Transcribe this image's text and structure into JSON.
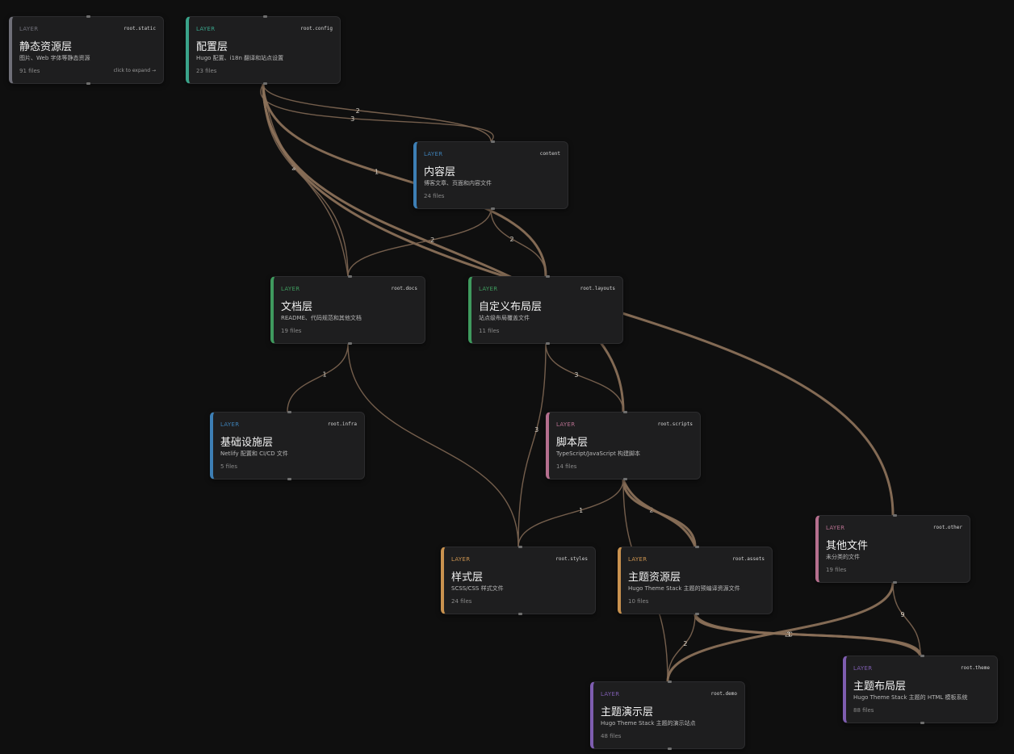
{
  "colors": {
    "background": "#0f0f0f",
    "card": "#1e1e1f",
    "edge": "#7a6350",
    "accent_gray": "#6f6f78",
    "accent_teal": "#3aa38a",
    "accent_blue": "#3d7fb5",
    "accent_green": "#3f9a5e",
    "accent_pink": "#b56f8e",
    "accent_orange": "#c9924f",
    "accent_purple": "#7e5db0"
  },
  "nodes": [
    {
      "key": "static",
      "layer_tag": "LAYER",
      "id": "root.static",
      "title": "静态资源层",
      "desc": "图片、Web 字体等静态资源",
      "count": "91 files",
      "link": "click to expand →",
      "accent": "#6f6f78"
    },
    {
      "key": "config",
      "layer_tag": "LAYER",
      "id": "root.config",
      "title": "配置层",
      "desc": "Hugo 配置、i18n 翻译和站点设置",
      "count": "23 files",
      "link": "",
      "accent": "#3aa38a"
    },
    {
      "key": "content",
      "layer_tag": "LAYER",
      "id": "content",
      "title": "内容层",
      "desc": "博客文章、页面和内容文件",
      "count": "24 files",
      "link": "",
      "accent": "#3d7fb5"
    },
    {
      "key": "docs",
      "layer_tag": "LAYER",
      "id": "root.docs",
      "title": "文档层",
      "desc": "README、代码规范和其他文档",
      "count": "19 files",
      "link": "",
      "accent": "#3f9a5e"
    },
    {
      "key": "custom_layouts",
      "layer_tag": "LAYER",
      "id": "root.layouts",
      "title": "自定义布局层",
      "desc": "站点级布局覆盖文件",
      "count": "11 files",
      "link": "",
      "accent": "#3f9a5e"
    },
    {
      "key": "infra",
      "layer_tag": "LAYER",
      "id": "root.infra",
      "title": "基础设施层",
      "desc": "Netlify 配置和 CI/CD 文件",
      "count": "5 files",
      "link": "",
      "accent": "#3d7fb5"
    },
    {
      "key": "scripts",
      "layer_tag": "LAYER",
      "id": "root.scripts",
      "title": "脚本层",
      "desc": "TypeScript/JavaScript 构建脚本",
      "count": "14 files",
      "link": "",
      "accent": "#b56f8e"
    },
    {
      "key": "other",
      "layer_tag": "LAYER",
      "id": "root.other",
      "title": "其他文件",
      "desc": "未分类的文件",
      "count": "19 files",
      "link": "",
      "accent": "#b56f8e"
    },
    {
      "key": "styles",
      "layer_tag": "LAYER",
      "id": "root.styles",
      "title": "样式层",
      "desc": "SCSS/CSS 样式文件",
      "count": "24 files",
      "link": "",
      "accent": "#c9924f"
    },
    {
      "key": "theme_assets",
      "layer_tag": "LAYER",
      "id": "root.assets",
      "title": "主题资源层",
      "desc": "Hugo Theme Stack 主题的预编译资源文件",
      "count": "10 files",
      "link": "",
      "accent": "#c9924f"
    },
    {
      "key": "theme_layouts",
      "layer_tag": "LAYER",
      "id": "root.theme",
      "title": "主题布局层",
      "desc": "Hugo Theme Stack 主题的 HTML 模板系统",
      "count": "88 files",
      "link": "",
      "accent": "#7e5db0"
    },
    {
      "key": "theme_demo",
      "layer_tag": "LAYER",
      "id": "root.demo",
      "title": "主题演示层",
      "desc": "Hugo Theme Stack 主题的演示站点",
      "count": "48 files",
      "link": "",
      "accent": "#7e5db0"
    }
  ],
  "edges": [
    {
      "from": "config",
      "to": "content",
      "label": "2"
    },
    {
      "from": "config",
      "to": "content",
      "label": "3"
    },
    {
      "from": "config",
      "to": "docs",
      "label": "2"
    },
    {
      "from": "config",
      "to": "docs",
      "label": "1"
    },
    {
      "from": "config",
      "to": "custom_layouts",
      "label": "1"
    },
    {
      "from": "config",
      "to": "scripts",
      "label": ""
    },
    {
      "from": "config",
      "to": "other",
      "label": ""
    },
    {
      "from": "content",
      "to": "docs",
      "label": "2"
    },
    {
      "from": "content",
      "to": "custom_layouts",
      "label": "2"
    },
    {
      "from": "docs",
      "to": "infra",
      "label": "1"
    },
    {
      "from": "docs",
      "to": "styles",
      "label": ""
    },
    {
      "from": "custom_layouts",
      "to": "scripts",
      "label": "3"
    },
    {
      "from": "custom_layouts",
      "to": "styles",
      "label": "3"
    },
    {
      "from": "scripts",
      "to": "styles",
      "label": "1"
    },
    {
      "from": "scripts",
      "to": "theme_assets",
      "label": "2"
    },
    {
      "from": "scripts",
      "to": "theme_assets",
      "label": ""
    },
    {
      "from": "scripts",
      "to": "theme_demo",
      "label": ""
    },
    {
      "from": "theme_assets",
      "to": "theme_demo",
      "label": "2"
    },
    {
      "from": "theme_assets",
      "to": "theme_layouts",
      "label": "20"
    },
    {
      "from": "theme_assets",
      "to": "theme_layouts",
      "label": "1"
    },
    {
      "from": "other",
      "to": "theme_demo",
      "label": ""
    },
    {
      "from": "other",
      "to": "theme_layouts",
      "label": "9"
    }
  ]
}
